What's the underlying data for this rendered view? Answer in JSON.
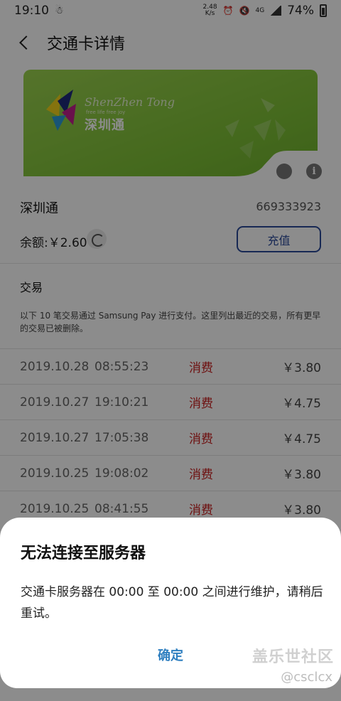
{
  "status_bar": {
    "time": "19:10",
    "net_speed_value": "2.48",
    "net_speed_unit": "K/s",
    "network_type": "4G",
    "battery": "74%"
  },
  "header": {
    "title": "交通卡详情"
  },
  "card": {
    "brand_en": "ShenZhen Tong",
    "slogan": "free life free joy",
    "brand_cn": "深圳通",
    "colors": {
      "card_green": "#7fc137"
    }
  },
  "info": {
    "card_name": "深圳通",
    "card_number": "669333923",
    "balance": "余额:￥2.60",
    "recharge_label": "充值"
  },
  "transactions": {
    "title": "交易",
    "description": "以下 10 笔交易通过 Samsung Pay 进行支付。这里列出最近的交易，所有更早的交易已被删除。",
    "rows": [
      {
        "date": "2019.10.28",
        "time": "08:55:23",
        "type": "消费",
        "amount": "￥3.80"
      },
      {
        "date": "2019.10.27",
        "time": "19:10:21",
        "type": "消费",
        "amount": "￥4.75"
      },
      {
        "date": "2019.10.27",
        "time": "17:05:38",
        "type": "消费",
        "amount": "￥4.75"
      },
      {
        "date": "2019.10.25",
        "time": "19:08:02",
        "type": "消费",
        "amount": "￥3.80"
      },
      {
        "date": "2019.10.25",
        "time": "08:41:55",
        "type": "消费",
        "amount": "￥3.80"
      }
    ]
  },
  "dialog": {
    "title": "无法连接至服务器",
    "message": "交通卡服务器在 00:00 至 00:00 之间进行维护，请稍后重试。",
    "confirm_label": "确定"
  },
  "watermark": {
    "main": "盖乐世社区",
    "sub": "@csclcx"
  }
}
